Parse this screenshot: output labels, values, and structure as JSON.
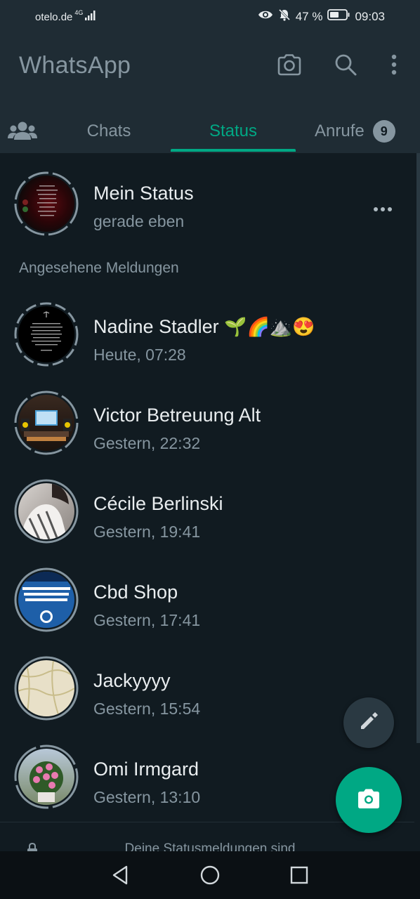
{
  "status_bar": {
    "carrier": "otelo.de",
    "network": "4G",
    "battery": "47 %",
    "time": "09:03"
  },
  "header": {
    "title": "WhatsApp",
    "icons": [
      "camera-icon",
      "search-icon",
      "more-vert-icon"
    ]
  },
  "tabs": {
    "community_icon": "community-icon",
    "items": [
      {
        "label": "Chats"
      },
      {
        "label": "Status"
      },
      {
        "label": "Anrufe",
        "badge": "9"
      }
    ],
    "active": "Status"
  },
  "my_status": {
    "name": "Mein Status",
    "time": "gerade eben"
  },
  "section": {
    "label": "Angesehene Meldungen"
  },
  "statuses": [
    {
      "name": "Nadine Stadler",
      "emojis": "🌱🌈⛰️😍",
      "time": "Heute, 07:28"
    },
    {
      "name": "Victor Betreuung  Alt",
      "time": "Gestern, 22:32"
    },
    {
      "name": "Cécile Berlinski",
      "time": "Gestern, 19:41"
    },
    {
      "name": "Cbd Shop",
      "time": "Gestern, 17:41"
    },
    {
      "name": "Jackyyyy",
      "time": "Gestern, 15:54"
    },
    {
      "name": "Omi Irmgard",
      "time": "Gestern, 13:10"
    }
  ],
  "footer": {
    "note": "Deine Statusmeldungen sind"
  },
  "colors": {
    "background": "#111b21",
    "header": "#1f2c34",
    "accent": "#00a884",
    "secondary_text": "#8696a0"
  }
}
